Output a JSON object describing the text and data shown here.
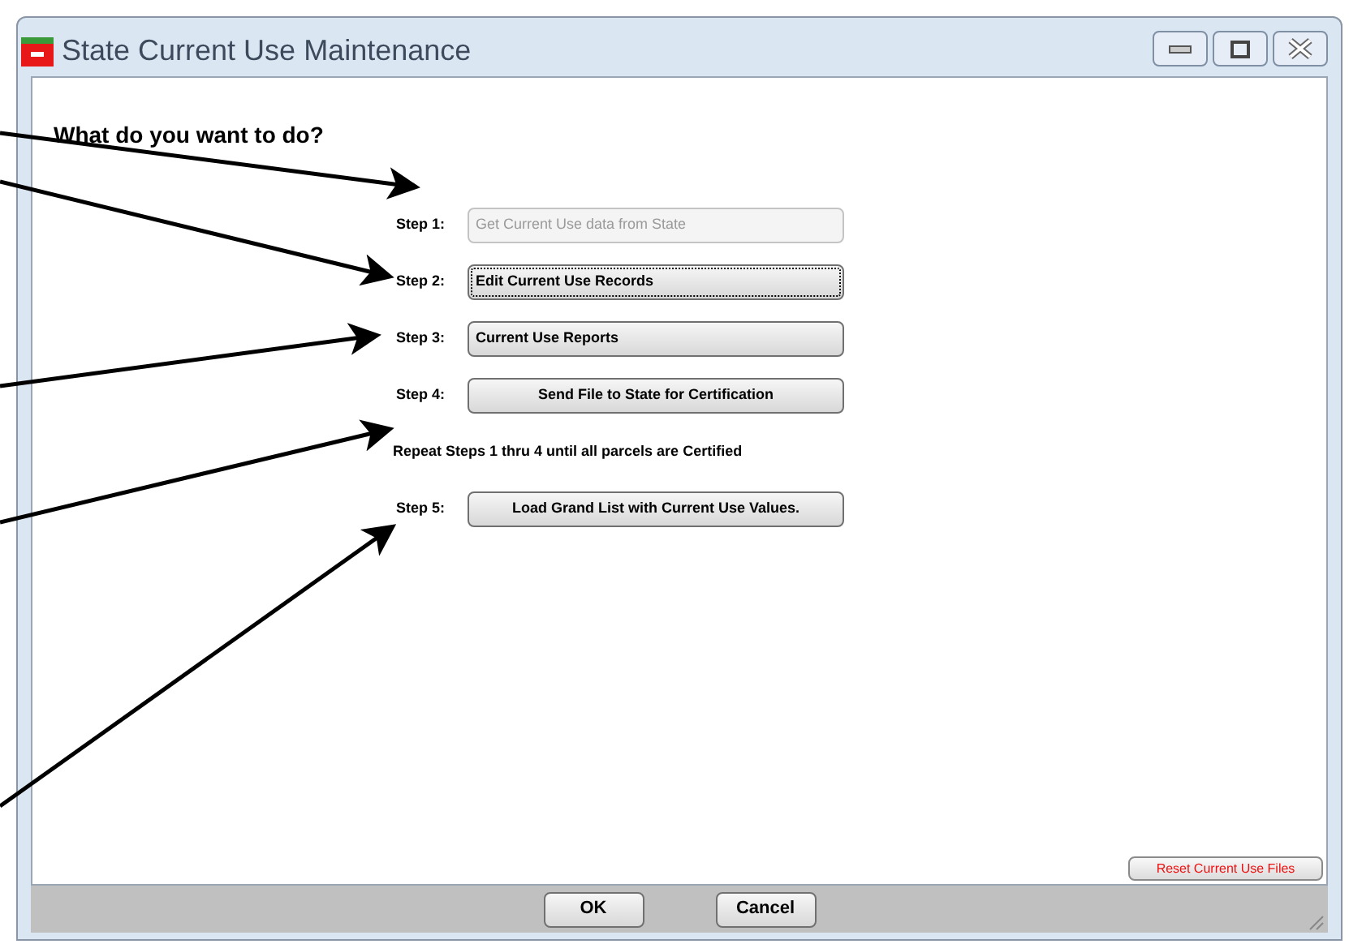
{
  "window": {
    "title": "State Current Use Maintenance"
  },
  "heading": "What do you want to do?",
  "steps": [
    {
      "kind": "step",
      "label": "Step 1:",
      "button": "Get Current Use data from State",
      "disabled": true,
      "focused": false,
      "centered": false
    },
    {
      "kind": "step",
      "label": "Step 2:",
      "button": "Edit Current Use Records",
      "disabled": false,
      "focused": true,
      "centered": false
    },
    {
      "kind": "step",
      "label": "Step 3:",
      "button": "Current Use Reports",
      "disabled": false,
      "focused": false,
      "centered": false
    },
    {
      "kind": "step",
      "label": "Step 4:",
      "button": "Send File to State for Certification",
      "disabled": false,
      "focused": false,
      "centered": true
    },
    {
      "kind": "note",
      "text": "Repeat Steps 1 thru 4 until all parcels are Certified"
    },
    {
      "kind": "step",
      "label": "Step 5:",
      "button": "Load Grand List with Current Use Values.",
      "disabled": false,
      "focused": false,
      "centered": true
    }
  ],
  "reset_button": "Reset Current Use Files",
  "buttons": [
    "OK",
    "Cancel"
  ]
}
